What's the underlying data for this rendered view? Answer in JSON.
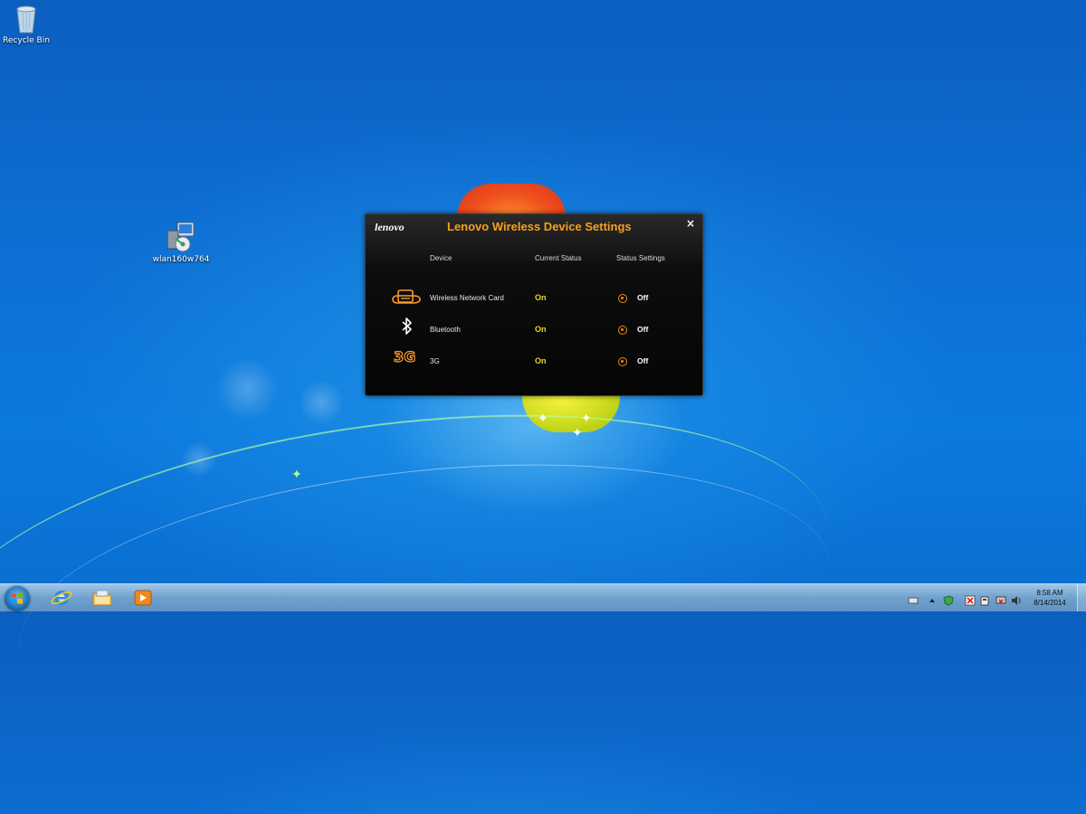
{
  "desktop": {
    "icons": [
      {
        "label": "Recycle Bin",
        "icon": "recycle-bin-icon"
      },
      {
        "label": "wlan160w764",
        "icon": "installer-icon"
      }
    ]
  },
  "dialog": {
    "logo": "lenovo",
    "title": "Lenovo Wireless Device Settings",
    "close_label": "×",
    "headers": {
      "device": "Device",
      "current_status": "Current Status",
      "status_settings": "Status Settings"
    },
    "rows": [
      {
        "name": "Wireless Network Card",
        "status": "On",
        "setting": "Off",
        "icon": "wifi-card-icon"
      },
      {
        "name": "Bluetooth",
        "status": "On",
        "setting": "Off",
        "icon": "bluetooth-icon"
      },
      {
        "name": "3G",
        "status": "On",
        "setting": "Off",
        "icon": "3g-icon"
      }
    ],
    "colors": {
      "accent": "#f7a01c",
      "status_on": "#e6d62a"
    }
  },
  "taskbar": {
    "pinned": [
      "internet-explorer-icon",
      "file-explorer-icon",
      "media-player-icon"
    ],
    "clock": {
      "time": "8:58 AM",
      "date": "8/14/2014"
    }
  }
}
